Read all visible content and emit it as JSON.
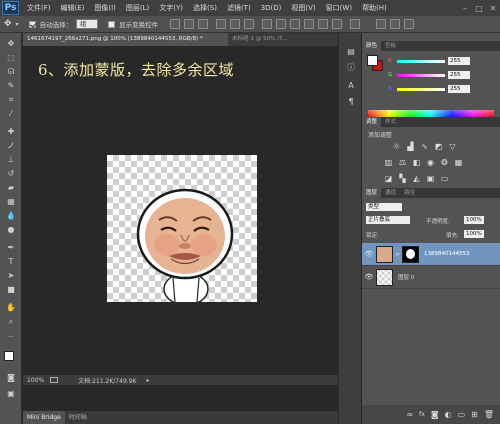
{
  "app": {
    "logo": "Ps"
  },
  "menu": [
    "文件(F)",
    "编辑(E)",
    "图像(I)",
    "图层(L)",
    "文字(Y)",
    "选择(S)",
    "滤镜(T)",
    "3D(D)",
    "视图(V)",
    "窗口(W)",
    "帮助(H)"
  ],
  "window_controls": [
    "–",
    "□",
    "✕"
  ],
  "options": {
    "auto_select_label": "自动选择：",
    "auto_select_target": "组",
    "transform_label": "显示变换控件"
  },
  "tabs": {
    "active": "1461674197_266x271.png @ 100% (1389840144553, RGB/8) *",
    "inactive": "未标题-1 @ 50% (5..."
  },
  "annotation": "6、添加蒙版，去除多余区域",
  "status": {
    "zoom": "100%",
    "doc": "文档:211.2K/749.9K"
  },
  "bottom_tabs": [
    "Mini Bridge",
    "时间轴"
  ],
  "color_panel": {
    "tabs": [
      "颜色",
      "色板"
    ],
    "r_label": "R",
    "r_value": "255",
    "g_label": "G",
    "g_value": "255",
    "b_label": "B",
    "b_value": "255",
    "fg_color": "#ffffff",
    "bg_color": "#cc1010"
  },
  "adjust_panel": {
    "tabs": [
      "调整",
      "样式"
    ],
    "title": "添加调整"
  },
  "layers_panel": {
    "tabs": [
      "图层",
      "通道",
      "路径"
    ],
    "filter": "类型",
    "blend_mode": "正片叠底",
    "opacity_label": "不透明度:",
    "opacity": "100%",
    "lock_label": "锁定:",
    "fill_label": "填充:",
    "fill": "100%",
    "layers": [
      {
        "name": "1389840144553",
        "has_mask": true,
        "selected": true
      },
      {
        "name": "图层 0",
        "has_mask": false,
        "selected": false
      }
    ]
  }
}
